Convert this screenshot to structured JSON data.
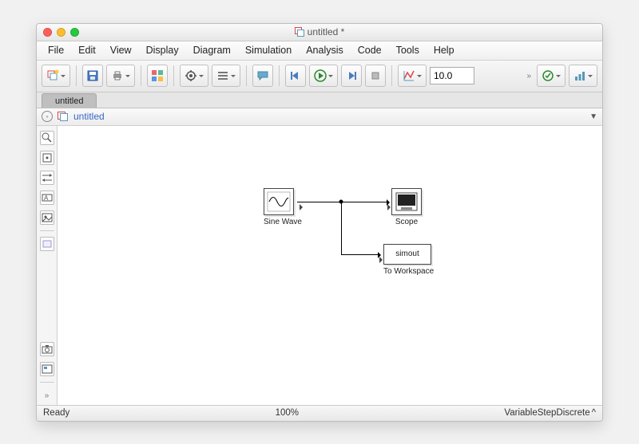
{
  "window": {
    "title": "untitled *"
  },
  "menus": [
    "File",
    "Edit",
    "View",
    "Display",
    "Diagram",
    "Simulation",
    "Analysis",
    "Code",
    "Tools",
    "Help"
  ],
  "toolbar": {
    "sim_time": "10.0"
  },
  "tab": {
    "label": "untitled"
  },
  "explorer": {
    "path": "untitled"
  },
  "blocks": {
    "sine": {
      "label": "Sine Wave"
    },
    "scope": {
      "label": "Scope"
    },
    "to_ws": {
      "label": "To Workspace",
      "var": "simout"
    }
  },
  "status": {
    "left": "Ready",
    "zoom": "100%",
    "solver": "VariableStepDiscrete"
  }
}
